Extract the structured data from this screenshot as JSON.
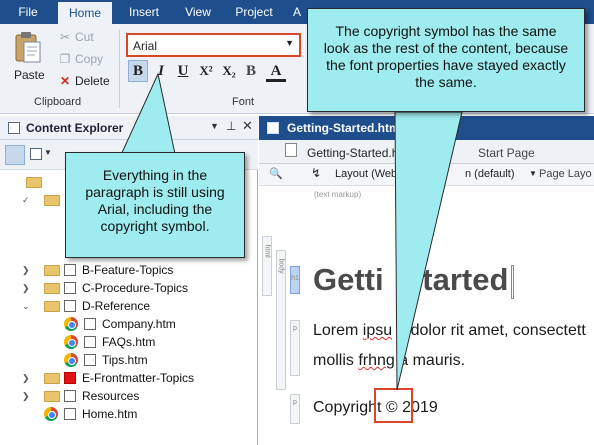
{
  "ribbon": {
    "tabs": [
      "File",
      "Home",
      "Insert",
      "View",
      "Project",
      "A"
    ],
    "active_tab": "Home",
    "clipboard": {
      "paste_label": "Paste",
      "cut_label": "Cut",
      "copy_label": "Copy",
      "delete_label": "Delete",
      "group_label": "Clipboard"
    },
    "font": {
      "font_family_value": "Arial",
      "bold": "B",
      "italic": "I",
      "underline": "U",
      "superscript": "X²",
      "subscript": "X₂",
      "clear_format": "B",
      "font_color": "A",
      "group_label": "Font"
    }
  },
  "content_explorer": {
    "title": "Content Explorer",
    "tree": [
      {
        "label": "B-Feature-Topics",
        "type": "folder"
      },
      {
        "label": "C-Procedure-Topics",
        "type": "folder"
      },
      {
        "label": "D-Reference",
        "type": "folder"
      },
      {
        "label": "Company.htm",
        "type": "file"
      },
      {
        "label": "FAQs.htm",
        "type": "file"
      },
      {
        "label": "Tips.htm",
        "type": "file"
      },
      {
        "label": "E-Frontmatter-Topics",
        "type": "folder"
      },
      {
        "label": "Resources",
        "type": "folder"
      },
      {
        "label": "Home.htm",
        "type": "file"
      }
    ]
  },
  "editor": {
    "document_tab": "Getting-Started.htm",
    "subtabs": [
      "Getting-Started.ht",
      "Start Page"
    ],
    "toolbar": {
      "layout": "Layout (Web",
      "medium": "n (default)",
      "page_layout": "Page Layo"
    },
    "text_markup_label": "(text markup)",
    "side_tags": [
      "html",
      "body",
      "h1",
      "p",
      "p"
    ],
    "heading": {
      "part1": "Getti",
      "part2": "Started"
    },
    "paragraph_parts": [
      "Lorem ",
      "ipsu",
      " dolor rit amet, consectett"
    ],
    "paragraph_line2": [
      "mollis ",
      "frhng",
      " a mauris."
    ],
    "copyright_line": "Copyright © 2019"
  },
  "callouts": {
    "right": "The copyright symbol has the same look as the rest of the content, because the font properties have stayed exactly the same.",
    "left": "Everything in the paragraph is still using Arial, including the copyright symbol."
  },
  "colors": {
    "ribbon_blue": "#1e4e8c",
    "callout_fill": "#9eecf0",
    "highlight_red": "#d9472b"
  }
}
